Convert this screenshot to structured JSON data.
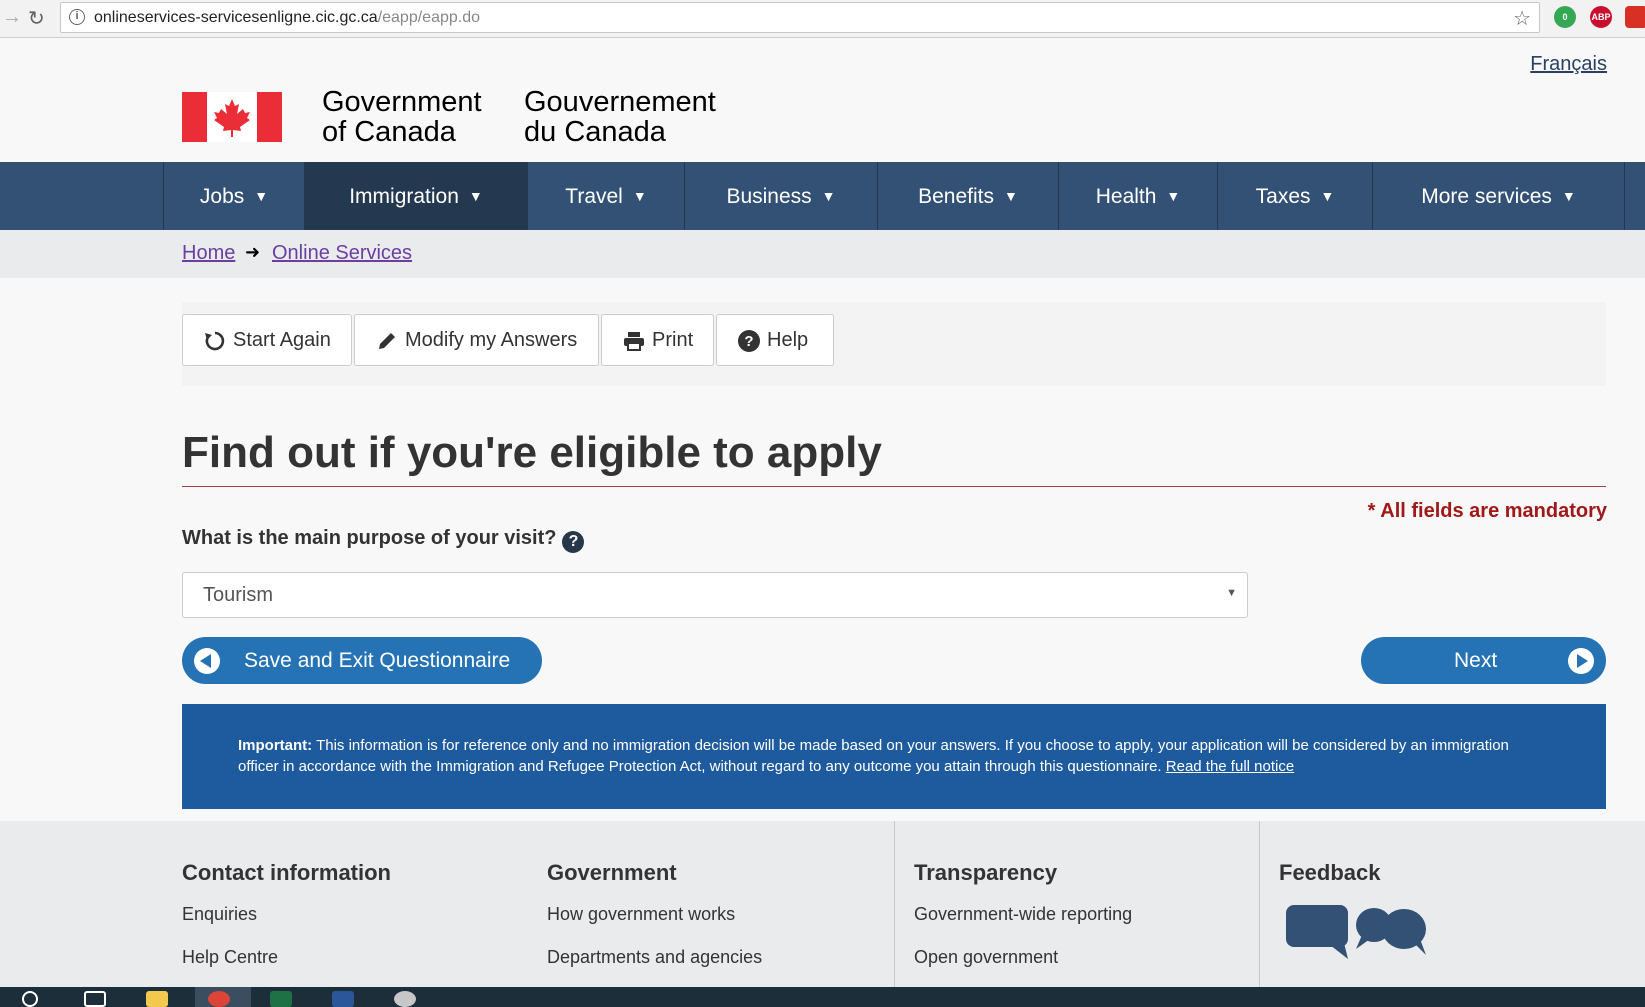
{
  "browser": {
    "url_host": "onlineservices-servicesenligne.cic.gc.ca",
    "url_path": "/eapp/eapp.do",
    "info_glyph": "i",
    "ext_badge_count": "0",
    "abp_label": "ABP"
  },
  "header": {
    "language_link": "Français",
    "gov_en_line1": "Government",
    "gov_en_line2": "of Canada",
    "gov_fr_line1": "Gouvernement",
    "gov_fr_line2": "du Canada"
  },
  "menu": {
    "items": [
      "Jobs",
      "Immigration",
      "Travel",
      "Business",
      "Benefits",
      "Health",
      "Taxes",
      "More services"
    ],
    "active": "Immigration"
  },
  "breadcrumb": {
    "home": "Home",
    "current": "Online Services"
  },
  "toolbar": {
    "start_again": "Start Again",
    "modify": "Modify my Answers",
    "print": "Print",
    "help": "Help"
  },
  "form": {
    "title": "Find out if you're eligible to apply",
    "mandatory": "* All fields are mandatory",
    "question": "What is the main purpose of your visit?",
    "help_glyph": "?",
    "selected": "Tourism",
    "save_exit": "Save and Exit Questionnaire",
    "next": "Next"
  },
  "notice": {
    "label": "Important:",
    "text": " This information is for reference only and no immigration decision will be made based on your answers. If you choose to apply, your application will be considered by an immigration officer in accordance with the Immigration and Refugee Protection Act, without regard to any outcome you attain through this questionnaire. ",
    "link": "Read the full notice"
  },
  "footer": {
    "contact": {
      "heading": "Contact information",
      "links": [
        "Enquiries",
        "Help Centre"
      ]
    },
    "government": {
      "heading": "Government",
      "links": [
        "How government works",
        "Departments and agencies"
      ]
    },
    "transparency": {
      "heading": "Transparency",
      "links": [
        "Government-wide reporting",
        "Open government"
      ]
    },
    "feedback": {
      "heading": "Feedback"
    }
  },
  "colors": {
    "nav_bg": "#335075",
    "nav_active": "#243850",
    "accent_button": "#2572b4",
    "notice_bg": "#1e5b9e",
    "mandatory": "#a01818",
    "flag_red": "#eb2d37"
  }
}
